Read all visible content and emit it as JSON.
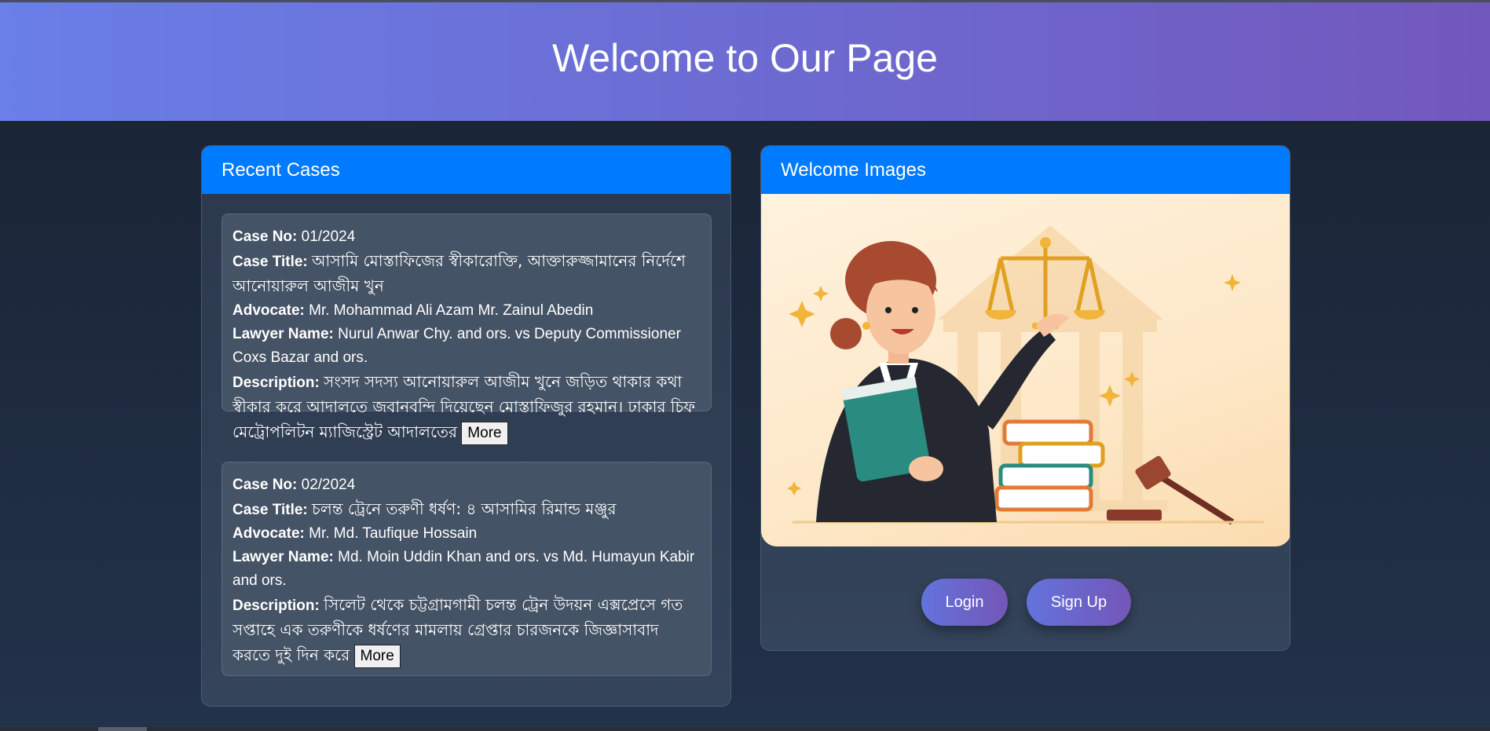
{
  "hero": {
    "title": "Welcome to Our Page"
  },
  "recent_cases": {
    "title": "Recent Cases",
    "labels": {
      "case_no": "Case No:",
      "case_title": "Case Title:",
      "advocate": "Advocate:",
      "lawyer_name": "Lawyer Name:",
      "description": "Description:"
    },
    "more_label": "More",
    "items": [
      {
        "case_no": "01/2024",
        "case_title": "আসামি মোস্তাফিজের স্বীকারোক্তি, আক্তারুজ্জামানের নির্দেশে আনোয়ারুল আজীম খুন",
        "advocate": "Mr. Mohammad Ali Azam Mr. Zainul Abedin",
        "lawyer_name": "Nurul Anwar Chy. and ors. vs Deputy Commissioner Coxs Bazar and ors.",
        "description": "সংসদ সদস্য আনোয়ারুল আজীম খুনে জড়িত থাকার কথা স্বীকার করে আদালতে জবানবন্দি দিয়েছেন মোস্তাফিজুর রহমান। ঢাকার চিফ মেট্রোপলিটন ম্যাজিস্ট্রেট আদালতের"
      },
      {
        "case_no": "02/2024",
        "case_title": "চলন্ত ট্রেনে তরুণী ধর্ষণ: ৪ আসামির রিমান্ড মঞ্জুর",
        "advocate": "Mr. Md. Taufique Hossain",
        "lawyer_name": "Md. Moin Uddin Khan and ors. vs Md. Humayun Kabir and ors.",
        "description": "সিলেট থেকে চট্টগ্রামগামী চলন্ত ট্রেন উদয়ন এক্সপ্রেসে গত সপ্তাহে এক তরুণীকে ধর্ষণের মামলায় গ্রেপ্তার চারজনকে জিজ্ঞাসাবাদ করতে দুই দিন করে"
      }
    ]
  },
  "welcome_images": {
    "title": "Welcome Images",
    "image_icon": "lawyer-justice-illustration",
    "login_label": "Login",
    "signup_label": "Sign Up"
  },
  "colors": {
    "header_blue": "#007bff",
    "hero_gradient_start": "#6a7fe8",
    "hero_gradient_end": "#7258bd",
    "page_bg": "#1b2738"
  }
}
